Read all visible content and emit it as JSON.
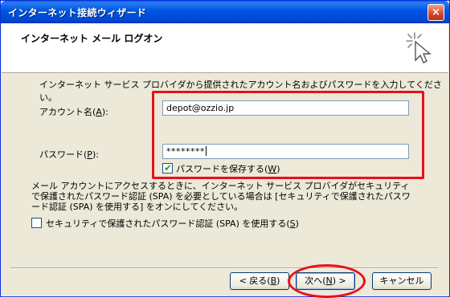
{
  "window": {
    "title": "インターネット接続ウィザード",
    "close_label": "×"
  },
  "header": {
    "title": "インターネット メール ログオン"
  },
  "intro_text": "インターネット サービス プロバイダから提供されたアカウント名およびパスワードを入力してください。",
  "account": {
    "label_pre": "アカウント名(",
    "accel": "A",
    "label_post": "):",
    "value": "depot@ozzio.jp"
  },
  "password": {
    "label_pre": "パスワード(",
    "accel": "P",
    "label_post": "):",
    "value": "********"
  },
  "save_password": {
    "checked": true,
    "label_pre": "パスワードを保存する(",
    "accel": "W",
    "label_post": ")"
  },
  "spa": {
    "description": "メール アカウントにアクセスするときに、インターネット サービス プロバイダがセキュリティで保護されたパスワード認証 (SPA) を必要としている場合は [セキュリティで保護されたパスワード認証 (SPA) を使用する] をオンにしてください。",
    "checked": false,
    "label_pre": "セキュリティで保護されたパスワード認証 (SPA) を使用する(",
    "accel": "S",
    "label_post": ")"
  },
  "buttons": {
    "back": {
      "pre": "< 戻る(",
      "accel": "B",
      "post": ")"
    },
    "next": {
      "pre": "次へ(",
      "accel": "N",
      "post": ") >"
    },
    "cancel": {
      "label": "キャンセル"
    }
  },
  "annotation_color": "#e8101a"
}
